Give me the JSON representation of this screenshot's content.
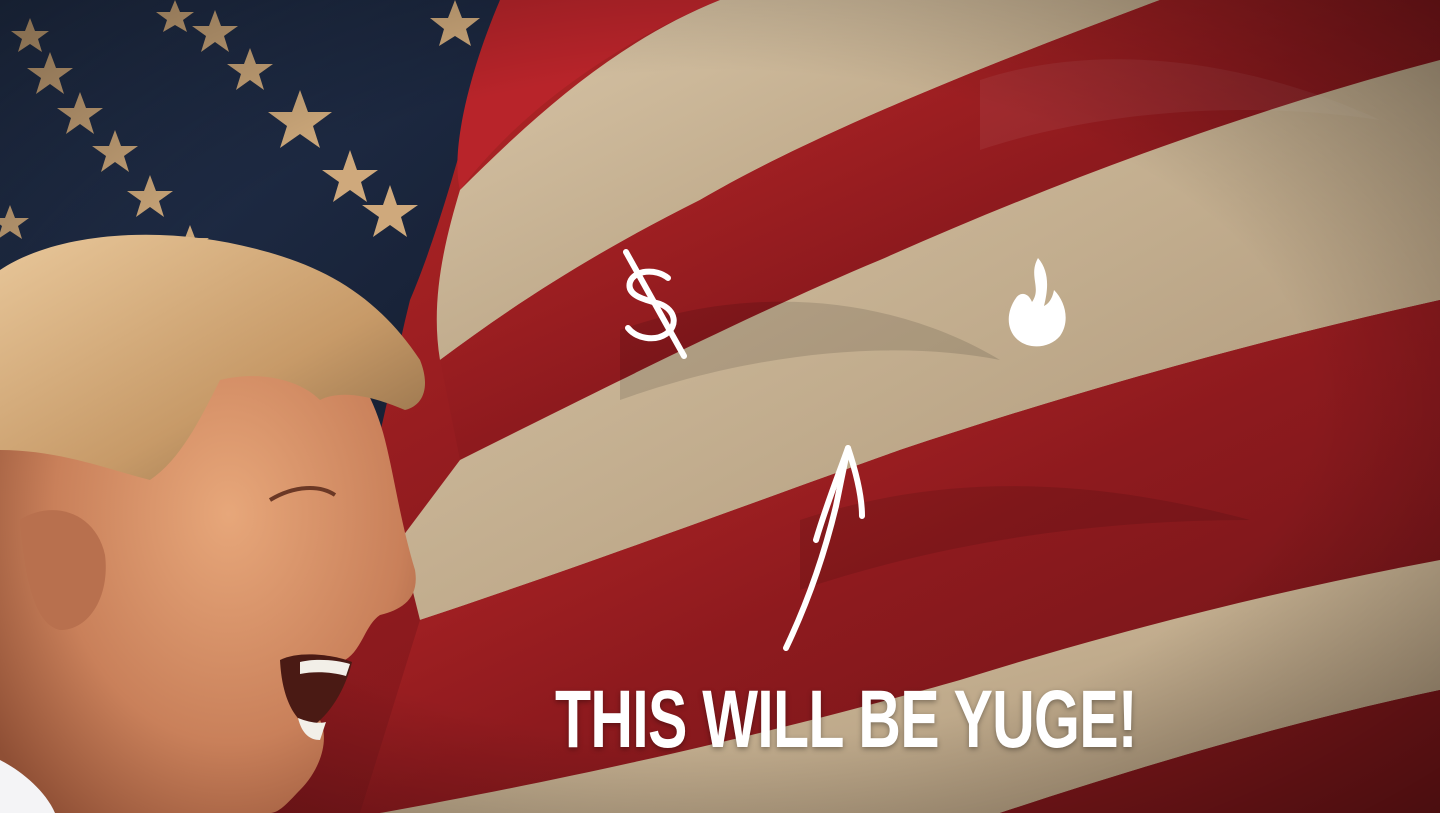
{
  "headline": {
    "text": "THIS WILL BE YUGE!"
  },
  "doodles": [
    {
      "icon": "dollar-sign-icon"
    },
    {
      "icon": "flame-icon"
    },
    {
      "icon": "up-arrow-icon"
    }
  ],
  "colors": {
    "stripe_red": "#9e1c1f",
    "stripe_white": "#cdb89a",
    "canton_blue": "#1f2c45",
    "star": "#e3b883",
    "headline": "#ffffff"
  }
}
